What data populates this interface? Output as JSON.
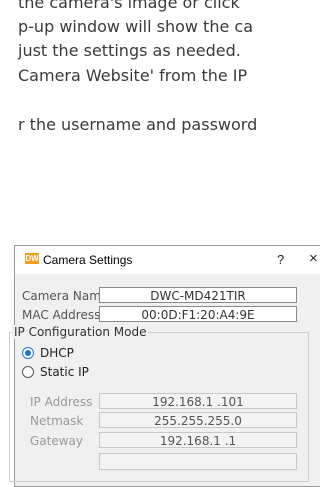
{
  "doc": {
    "line1": "the camera's image or click",
    "line2": "p-up window will show the ca",
    "line3": "just the settings as needed.",
    "line4": "Camera Website' from the IP",
    "line5": "r the username and password"
  },
  "window": {
    "logo_text": "DW",
    "title": "Camera Settings",
    "help_icon": "?",
    "close_icon": "×"
  },
  "fields": {
    "camera_name_label": "Camera Name",
    "camera_name_value": "DWC-MD421TIR",
    "mac_label": "MAC Address",
    "mac_value": "00:0D:F1:20:A4:9E"
  },
  "ip_config": {
    "group_title": "IP Configuration Mode",
    "dhcp_label": "DHCP",
    "static_label": "Static IP",
    "selected": "DHCP",
    "ip_label": "IP Address",
    "ip_value": "192.168.1 .101",
    "netmask_label": "Netmask",
    "netmask_value": "255.255.255.0",
    "gateway_label": "Gateway",
    "gateway_value": "192.168.1 .1"
  }
}
